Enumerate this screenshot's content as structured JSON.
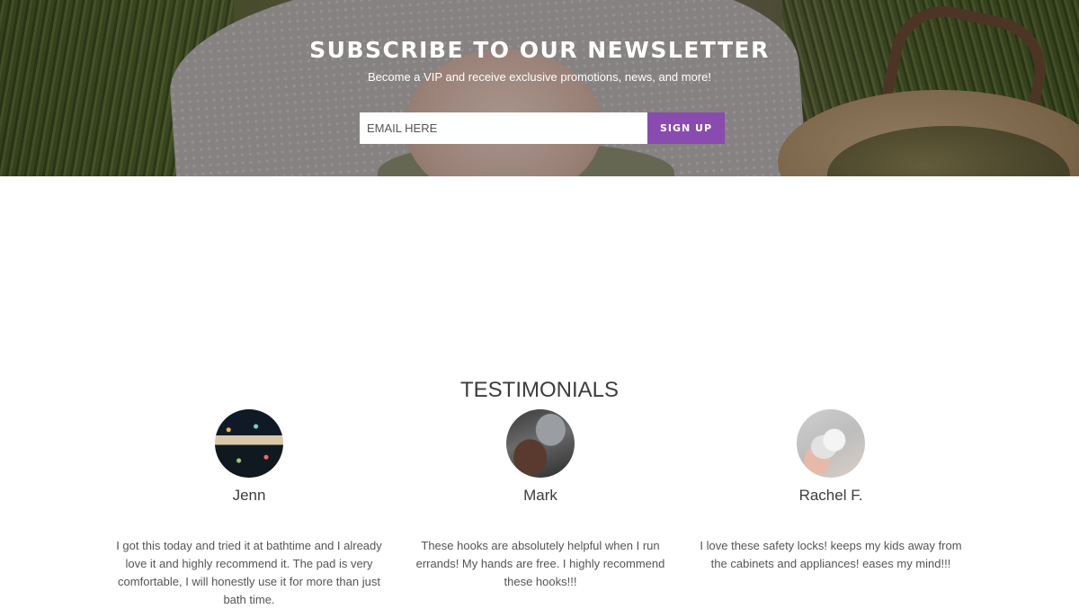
{
  "newsletter": {
    "title": "SUBSCRIBE TO OUR NEWSLETTER",
    "subtitle": "Become a VIP and receive exclusive promotions, news, and more!",
    "email_placeholder": "EMAIL HERE",
    "signup_label": "SIGN UP",
    "button_color": "#8a4bb0"
  },
  "testimonials": {
    "title": "TESTIMONIALS",
    "items": [
      {
        "name": "Jenn",
        "quote": "I got this today and tried it at bathtime and I already love it and highly recommend it. The pad is very comfortable, I will honestly use it for more than just bath time."
      },
      {
        "name": "Mark",
        "quote": "These hooks are absolutely helpful when I run errands! My hands are free. I highly recommend these hooks!!!"
      },
      {
        "name": "Rachel F.",
        "quote": "I love these safety locks! keeps my kids away from the cabinets and appliances! eases my mind!!!"
      }
    ]
  }
}
